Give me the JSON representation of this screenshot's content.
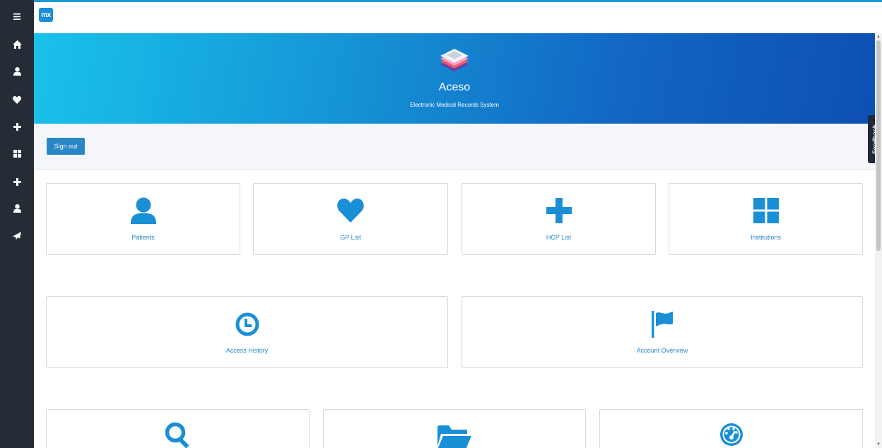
{
  "app": {
    "name": "Aceso",
    "subtitle": "Electronic Medical Records System",
    "logo_text": "mx"
  },
  "colors": {
    "accent": "#1b9ad8",
    "sidebar": "#252c36",
    "button": "#2a87c6",
    "icon": "#1a8fd5"
  },
  "sidebar": {
    "items": [
      {
        "icon": "menu-icon"
      },
      {
        "icon": "home-icon"
      },
      {
        "icon": "user-icon"
      },
      {
        "icon": "heart-icon"
      },
      {
        "icon": "plus-icon"
      },
      {
        "icon": "grid-icon"
      },
      {
        "icon": "plus-icon"
      },
      {
        "icon": "user-icon"
      },
      {
        "icon": "paper-plane-icon"
      }
    ]
  },
  "actions": {
    "sign_out": "Sign out",
    "feedback": "Feedback"
  },
  "tiles": [
    {
      "label": "Patients",
      "icon": "user-icon"
    },
    {
      "label": "GP List",
      "icon": "heart-icon"
    },
    {
      "label": "HCP List",
      "icon": "plus-icon"
    },
    {
      "label": "Institutions",
      "icon": "grid-icon"
    },
    {
      "label": "Access History",
      "icon": "clock-icon"
    },
    {
      "label": "Account Overview",
      "icon": "flag-icon"
    },
    {
      "label": "",
      "icon": "search-icon"
    },
    {
      "label": "",
      "icon": "folder-open-icon"
    },
    {
      "label": "",
      "icon": "dashboard-icon"
    }
  ]
}
